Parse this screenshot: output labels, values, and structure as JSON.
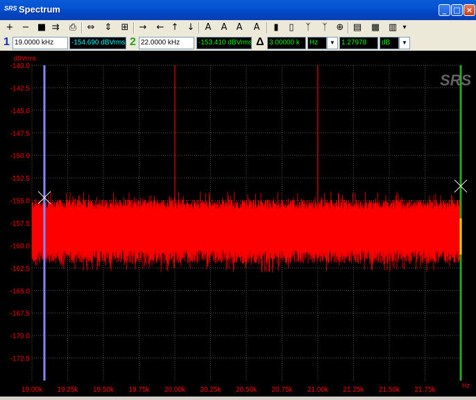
{
  "window": {
    "title": "Spectrum",
    "icon_text": "SRS",
    "buttons": [
      "_",
      "□",
      "×"
    ]
  },
  "toolbar": {
    "items": [
      {
        "name": "zoom-in-icon",
        "glyph": "+"
      },
      {
        "name": "zoom-out-icon",
        "glyph": "−"
      },
      {
        "name": "save-icon",
        "glyph": "■"
      },
      {
        "name": "export-icon",
        "glyph": "⇉"
      },
      {
        "name": "print-icon",
        "glyph": "⎙"
      },
      {
        "name": "fit-horizontal-icon",
        "glyph": "⇔"
      },
      {
        "name": "fit-vertical-icon",
        "glyph": "⇕"
      },
      {
        "name": "fit-all-icon",
        "glyph": "⊞"
      },
      {
        "name": "arrow-right-icon",
        "glyph": "→"
      },
      {
        "name": "arrow-left-icon",
        "glyph": "←"
      },
      {
        "name": "arrow-up-icon",
        "glyph": "↑"
      },
      {
        "name": "arrow-down-icon",
        "glyph": "↓"
      },
      {
        "name": "cursor-a-icon",
        "glyph": "A"
      },
      {
        "name": "cursor-b-icon",
        "glyph": "A"
      },
      {
        "name": "cursor-peak-icon",
        "glyph": "A"
      },
      {
        "name": "cursor-peak2-icon",
        "glyph": "A"
      },
      {
        "name": "bar-color-icon",
        "glyph": "▮"
      },
      {
        "name": "bar-scale-icon",
        "glyph": "▯"
      },
      {
        "name": "peak-marker-icon",
        "glyph": "ᛉ"
      },
      {
        "name": "peak-marker2-icon",
        "glyph": "ᛉ"
      },
      {
        "name": "target-icon",
        "glyph": "⊕"
      },
      {
        "name": "properties-icon",
        "glyph": "▤"
      },
      {
        "name": "table-icon",
        "glyph": "▦"
      },
      {
        "name": "calculator-icon",
        "glyph": "▥"
      },
      {
        "name": "dropdown-icon",
        "glyph": "▾"
      }
    ]
  },
  "cursors": {
    "c1_number": "1",
    "c1_freq": "19.0000 kHz",
    "c1_level": "-154.690 dBVrms",
    "c2_number": "2",
    "c2_freq": "22.0000 kHz",
    "c2_level": "-153.410 dBVrms",
    "delta_symbol": "Δ",
    "delta_freq": "3.00000 k",
    "delta_freq_unit": "Hz",
    "delta_level": "1.27978",
    "delta_level_unit": "dB"
  },
  "colors": {
    "trace": "#ff0000",
    "cursor1": "#8888ff",
    "cursor2": "#22aa22",
    "axis_text": "#ff0000",
    "grid": "#555555",
    "cursor1_label": "#1030c0",
    "cursor2_label": "#20a020"
  },
  "chart_data": {
    "type": "line",
    "ylabel": "dBVrms",
    "xlabel": "Hz",
    "xlim": [
      19000,
      22000
    ],
    "ylim": [
      -175,
      -140
    ],
    "y_ticks": [
      "-140.0",
      "-142.5",
      "-145.0",
      "-147.5",
      "-150.0",
      "-152.5",
      "-155.0",
      "-157.5",
      "-160.0",
      "-162.5",
      "-165.0",
      "-167.5",
      "-170.0",
      "-172.5"
    ],
    "x_ticks": [
      "19.00k",
      "19.25k",
      "19.50k",
      "19.75k",
      "20.00k",
      "20.25k",
      "20.50k",
      "20.75k",
      "21.00k",
      "21.25k",
      "21.50k",
      "21.75k"
    ],
    "x_tick_values": [
      19000,
      19250,
      19500,
      19750,
      20000,
      20250,
      20500,
      20750,
      21000,
      21250,
      21500,
      21750
    ],
    "noise_floor": {
      "center": -158.5,
      "min": -163,
      "max": -154
    },
    "spurs": [
      {
        "x": 20000,
        "y": -140.0
      },
      {
        "x": 21000,
        "y": -140.0
      }
    ],
    "cursor_markers": [
      {
        "x": 19000,
        "y": -154.69
      },
      {
        "x": 22000,
        "y": -153.41
      }
    ],
    "logo": "SRS",
    "grid": true
  }
}
